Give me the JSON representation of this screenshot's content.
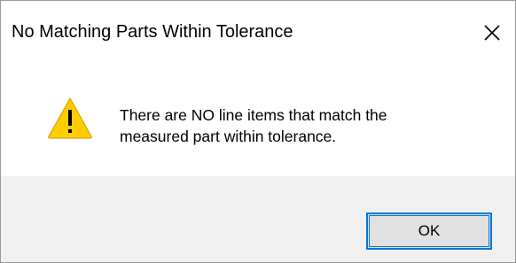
{
  "window": {
    "title": "No Matching Parts Within Tolerance",
    "close_icon": "close-icon"
  },
  "content": {
    "icon": "warning-icon",
    "message_line1": "There are NO line items that match the",
    "message_line2": "measured part within tolerance."
  },
  "footer": {
    "ok_label": "OK"
  },
  "colors": {
    "accent": "#0078d7",
    "warning_yellow": "#ffcc00",
    "footer_bg": "#f0f0f0",
    "button_bg": "#e1e1e1"
  }
}
